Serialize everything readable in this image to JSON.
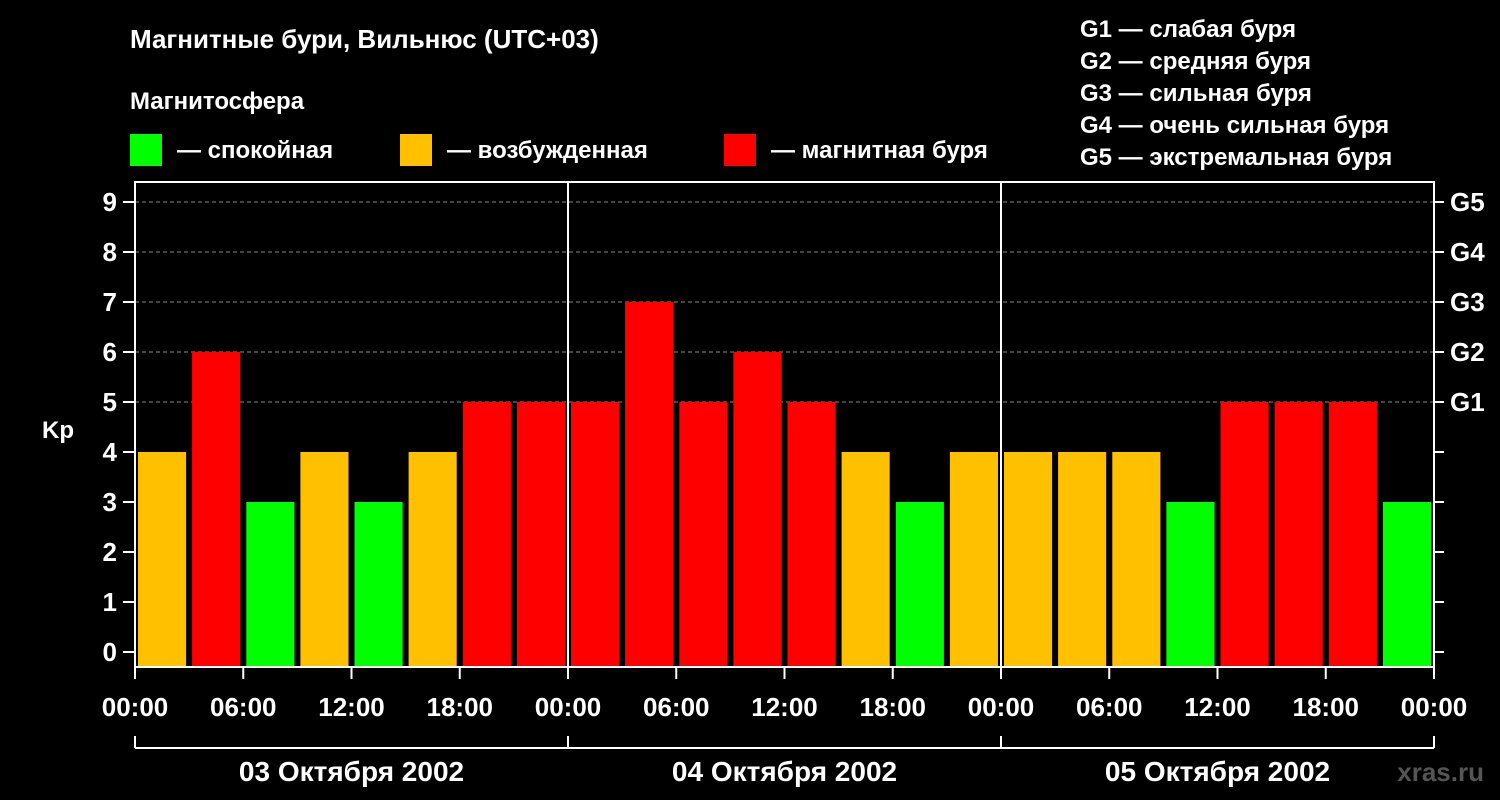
{
  "header": {
    "title": "Магнитные бури, Вильнюс (UTC+03)",
    "subtitle": "Магнитосфера"
  },
  "legend": [
    {
      "label": "— спокойная",
      "color": "#00FF00"
    },
    {
      "label": "— возбужденная",
      "color": "#FFC000"
    },
    {
      "label": "— магнитная буря",
      "color": "#FF0000"
    }
  ],
  "g_legend": [
    "G1 — слабая буря",
    "G2 — средняя буря",
    "G3 — сильная буря",
    "G4 — очень сильная буря",
    "G5 — экстремальная буря"
  ],
  "watermark": "xras.ru",
  "colors": {
    "quiet": "#00FF00",
    "active": "#FFC000",
    "storm": "#FF0000",
    "background": "#000000",
    "grid": "#888888",
    "axis": "#FFFFFF"
  },
  "chart_data": {
    "type": "bar",
    "ylabel": "Kp",
    "ylim": [
      0,
      9
    ],
    "y_ticks": [
      "0",
      "1",
      "2",
      "3",
      "4",
      "5",
      "6",
      "7",
      "8",
      "9"
    ],
    "right_ticks": [
      {
        "kp": 5,
        "label": "G1"
      },
      {
        "kp": 6,
        "label": "G2"
      },
      {
        "kp": 7,
        "label": "G3"
      },
      {
        "kp": 8,
        "label": "G4"
      },
      {
        "kp": 9,
        "label": "G5"
      }
    ],
    "x_ticks": [
      "00:00",
      "06:00",
      "12:00",
      "18:00",
      "00:00",
      "06:00",
      "12:00",
      "18:00",
      "00:00",
      "06:00",
      "12:00",
      "18:00",
      "00:00"
    ],
    "days": [
      "03 Октября 2002",
      "04 Октября 2002",
      "05 Октября 2002"
    ],
    "values": [
      4,
      6,
      3,
      4,
      3,
      4,
      5,
      5,
      5,
      7,
      5,
      6,
      5,
      4,
      3,
      4,
      4,
      4,
      4,
      3,
      5,
      5,
      5,
      3
    ],
    "grid": true
  }
}
